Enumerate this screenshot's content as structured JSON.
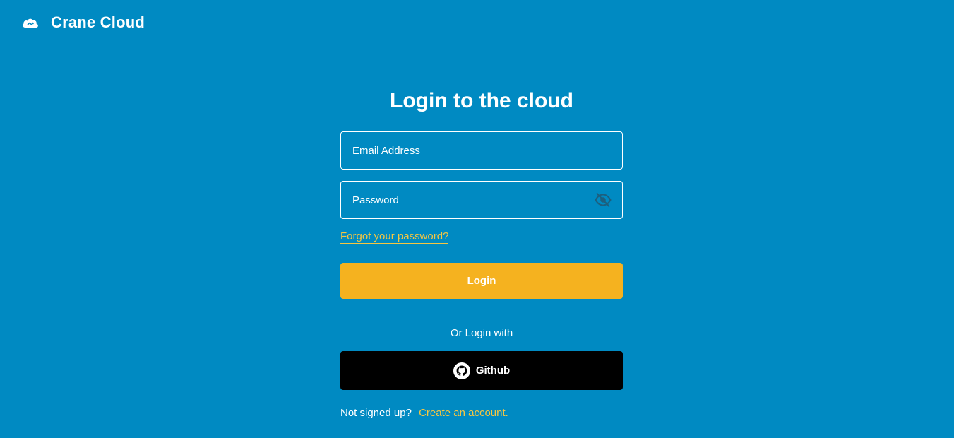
{
  "header": {
    "brand": "Crane Cloud",
    "logo_icon": "cloud-logo-icon"
  },
  "login": {
    "title": "Login to the cloud",
    "email_placeholder": "Email Address",
    "email_value": "",
    "password_placeholder": "Password",
    "password_value": "",
    "password_toggle_icon": "eye-off-icon",
    "forgot_link": "Forgot your password?",
    "submit_label": "Login"
  },
  "social": {
    "divider_text": "Or Login with",
    "github_label": "Github",
    "github_icon": "github-icon"
  },
  "signup": {
    "prompt": "Not signed up?",
    "link": "Create an account."
  },
  "colors": {
    "background": "#008AC2",
    "accent": "#F5B21F",
    "link": "#F5C642",
    "github_bg": "#000000"
  }
}
